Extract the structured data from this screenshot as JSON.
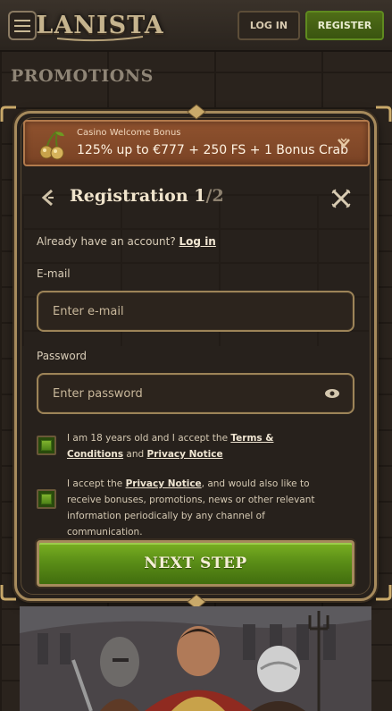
{
  "header": {
    "logo": "LANISTA",
    "login_label": "LOG IN",
    "register_label": "REGISTER"
  },
  "page": {
    "title": "PROMOTIONS"
  },
  "bonus": {
    "label": "Casino Welcome Bonus",
    "text": "125% up to €777 + 250 FS + 1 Bonus Crab"
  },
  "registration": {
    "title": "Registration 1",
    "step_suffix": "/2",
    "already_text": "Already have an account?",
    "login_link": "Log in"
  },
  "form": {
    "email_label": "E-mail",
    "email_placeholder": "Enter e-mail",
    "password_label": "Password",
    "password_placeholder": "Enter password"
  },
  "consents": {
    "age_pre": "I am 18 years old and I accept the ",
    "age_terms_link": "Terms & Conditions",
    "age_and": " and ",
    "age_privacy_link": "Privacy Notice",
    "marketing_pre": "I accept the ",
    "marketing_privacy_link": "Privacy Notice",
    "marketing_post": ", and would also like to receive bonuses, promotions, news or other relevant information periodically by any channel of communication."
  },
  "actions": {
    "next_label": "NEXT STEP"
  },
  "colors": {
    "accent_green": "#5b8e17",
    "gold_border": "#a68a5c",
    "bonus_bg": "#8f522e"
  }
}
